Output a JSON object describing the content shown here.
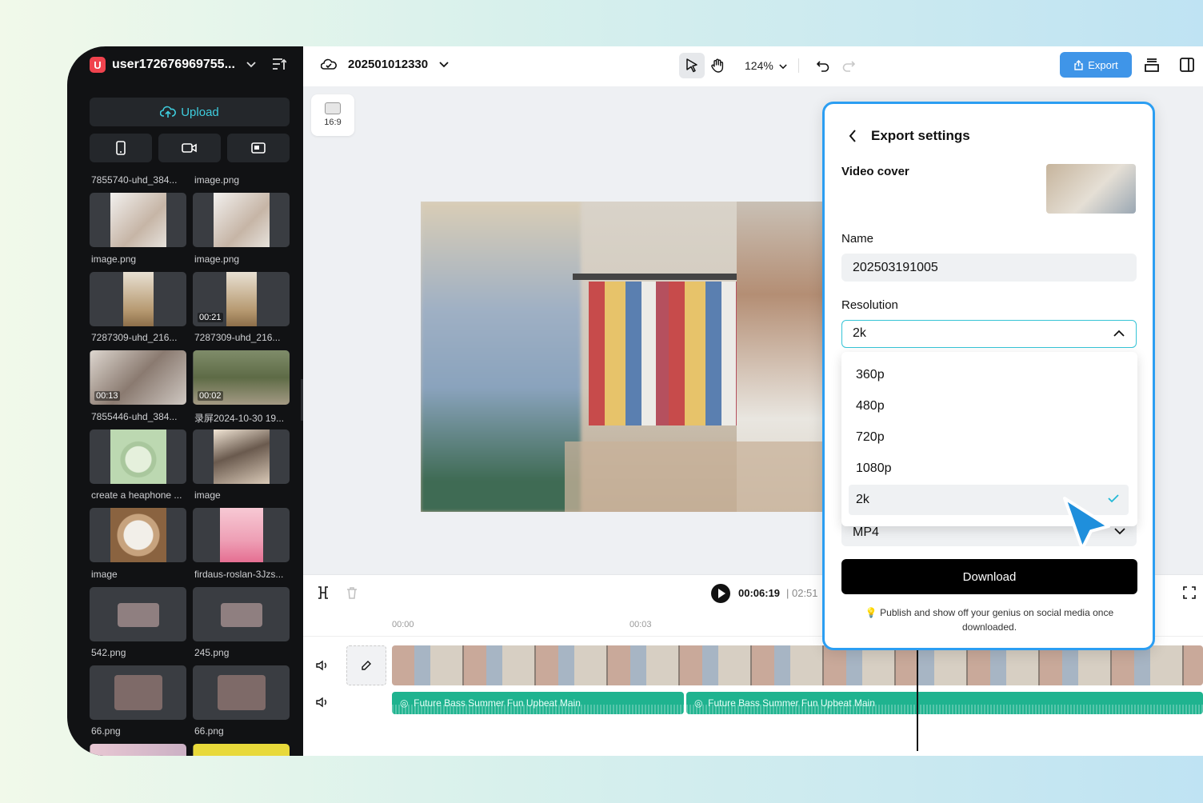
{
  "sidebar": {
    "user_badge": "U",
    "user_name": "user172676969755...",
    "upload_label": "Upload",
    "media": [
      {
        "caption": "7855740-uhd_384...",
        "duration": ""
      },
      {
        "caption": "image.png",
        "duration": ""
      },
      {
        "caption": "image.png",
        "duration": ""
      },
      {
        "caption": "image.png",
        "duration": ""
      },
      {
        "caption": "7287309-uhd_216...",
        "duration": ""
      },
      {
        "caption": "7287309-uhd_216...",
        "duration": "00:21"
      },
      {
        "caption": "7855446-uhd_384...",
        "duration": "00:13"
      },
      {
        "caption": "录屏2024-10-30 19...",
        "duration": "00:02"
      },
      {
        "caption": "create a heaphone ...",
        "duration": ""
      },
      {
        "caption": "image",
        "duration": ""
      },
      {
        "caption": "image",
        "duration": ""
      },
      {
        "caption": "firdaus-roslan-3Jzs...",
        "duration": ""
      },
      {
        "caption": "542.png",
        "duration": ""
      },
      {
        "caption": "245.png",
        "duration": ""
      },
      {
        "caption": "66.png",
        "duration": ""
      },
      {
        "caption": "66.png",
        "duration": ""
      }
    ]
  },
  "topbar": {
    "project_name": "202501012330",
    "zoom": "124%",
    "export_label": "Export"
  },
  "canvas": {
    "ratio_label": "16:9"
  },
  "timeline": {
    "current_time": "00:06:19",
    "total_time": "| 02:51",
    "ruler": [
      "00:00",
      "00:03"
    ],
    "audio_clips": [
      "Future Bass Summer Fun Upbeat Main",
      "Future Bass Summer Fun Upbeat Main"
    ]
  },
  "export_panel": {
    "title": "Export settings",
    "video_cover_label": "Video cover",
    "name_label": "Name",
    "name_value": "202503191005",
    "resolution_label": "Resolution",
    "resolution_value": "2k",
    "resolution_options": [
      "360p",
      "480p",
      "720p",
      "1080p",
      "2k"
    ],
    "format_value": "MP4",
    "download_label": "Download",
    "tip": "Publish and show off your genius on social media once downloaded."
  },
  "colors": {
    "accent": "#2b9ef2",
    "export": "#3f95e8",
    "audio": "#1fb38f",
    "sidebar": "#111214"
  }
}
